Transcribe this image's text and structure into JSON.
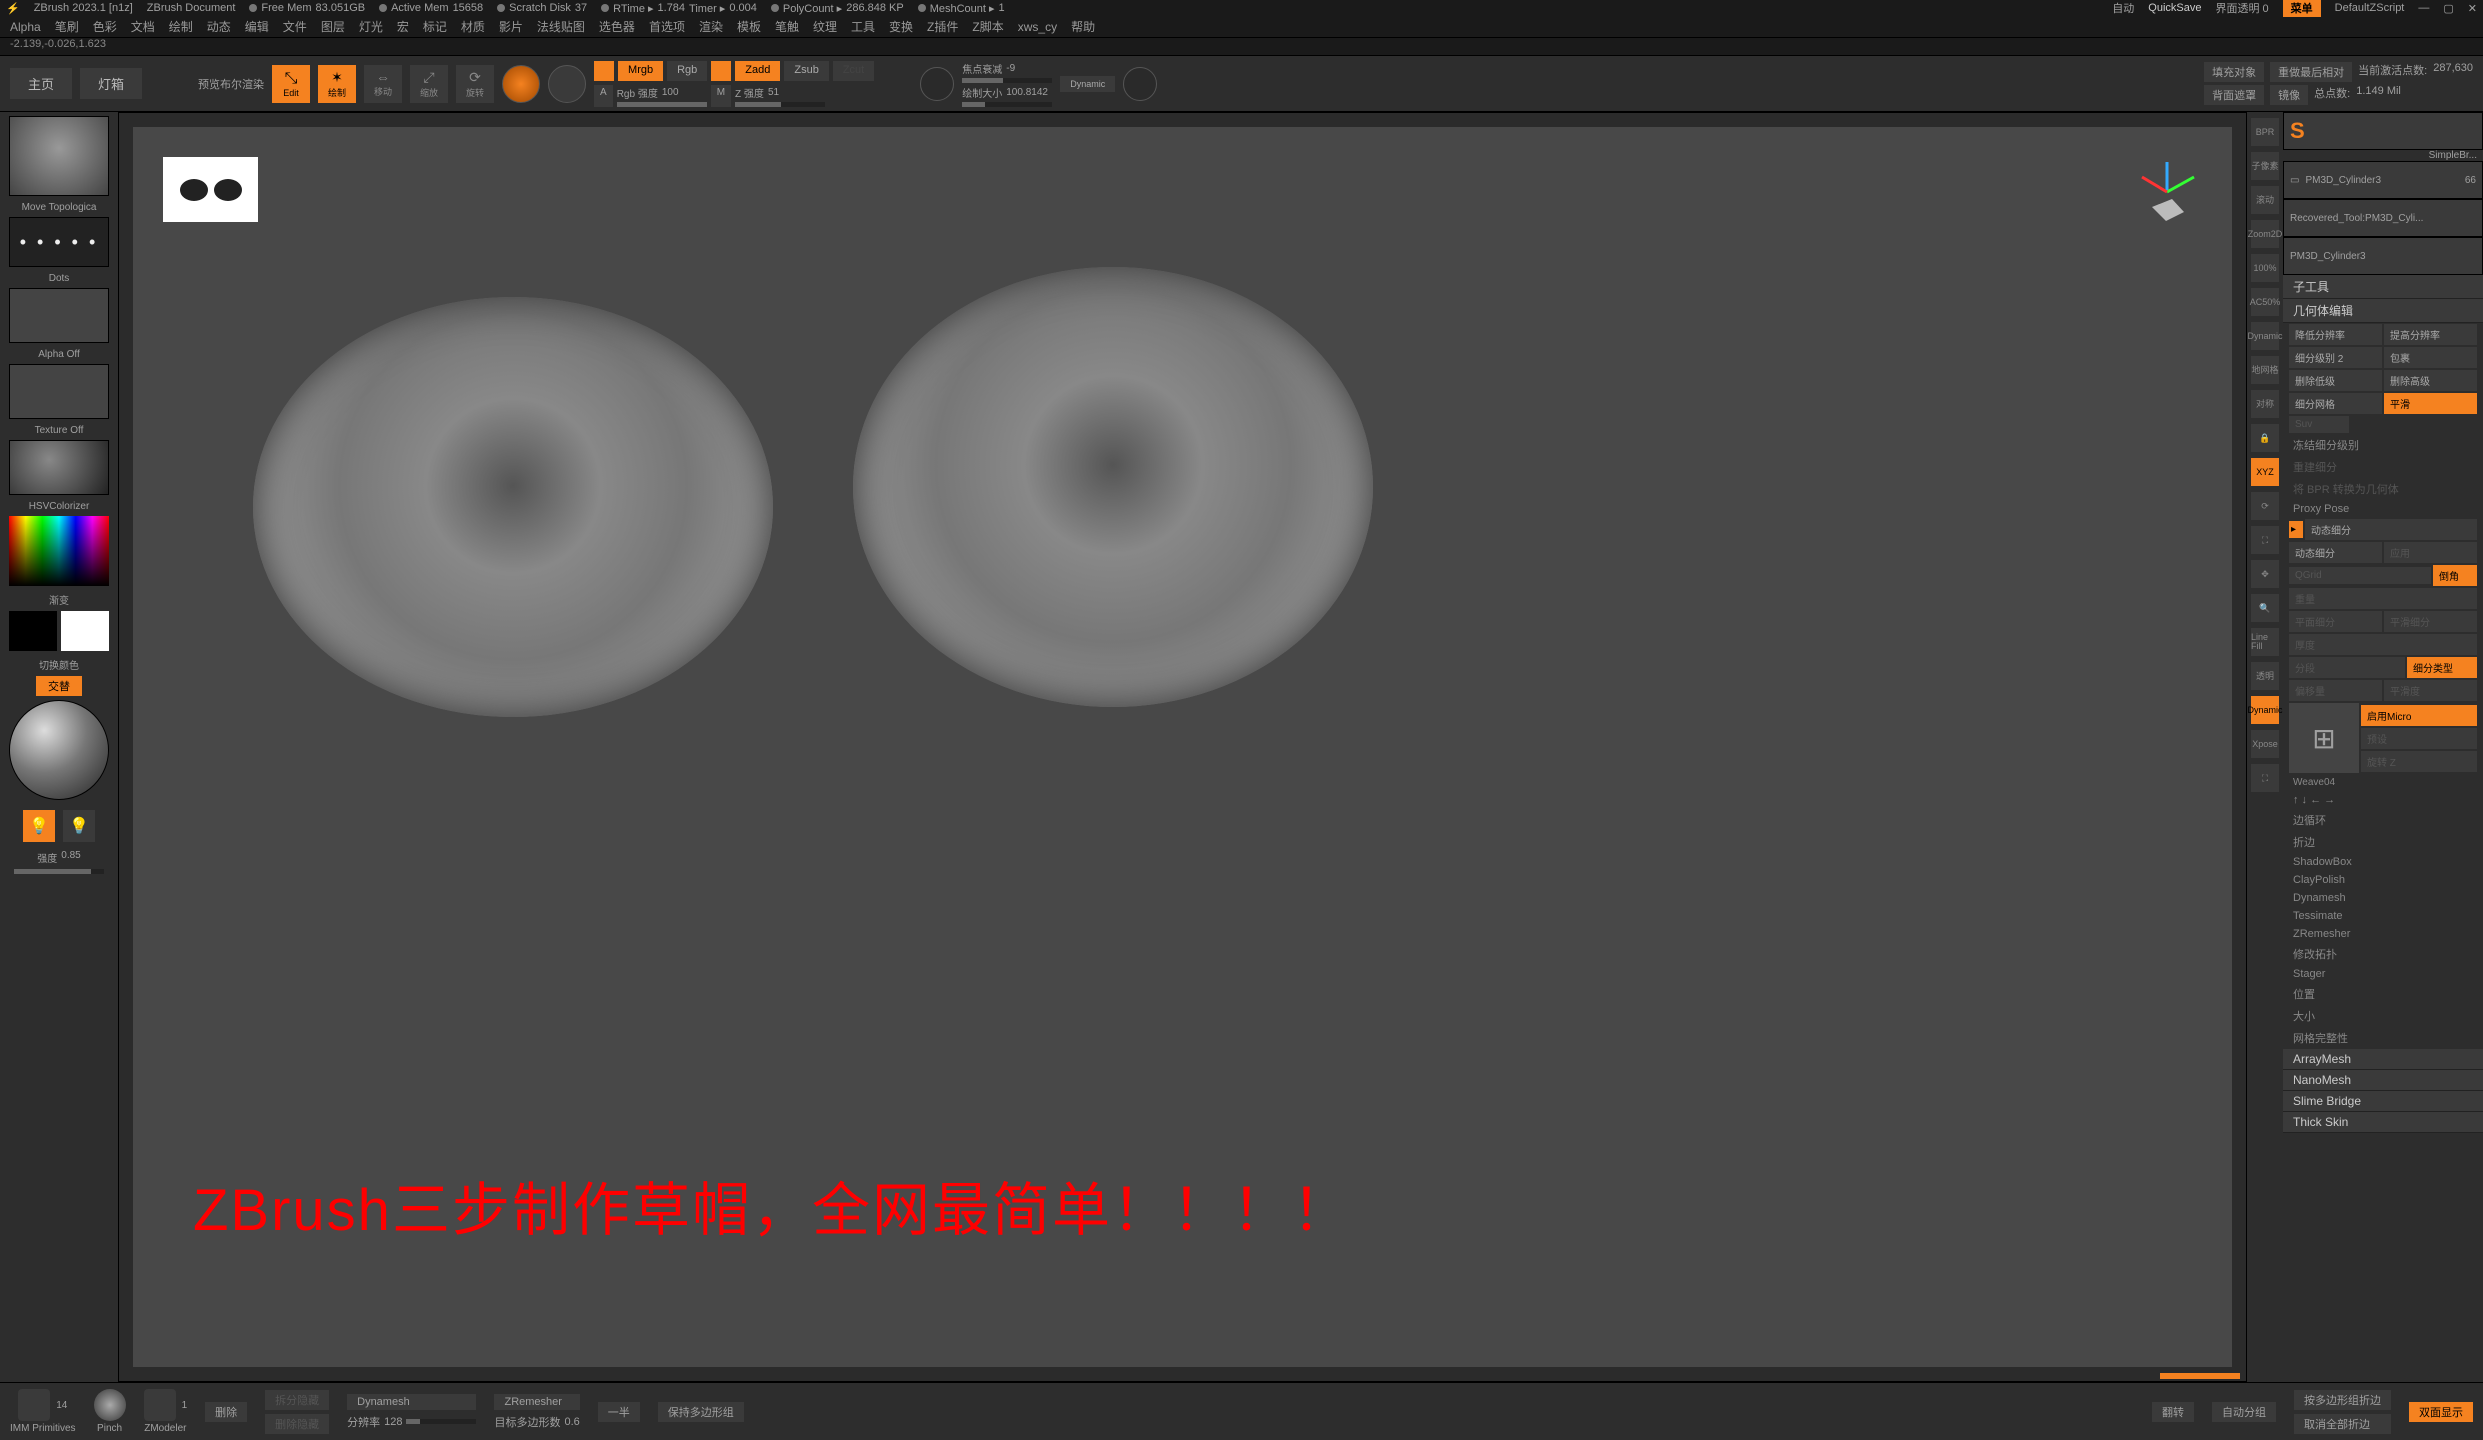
{
  "titlebar": {
    "app": "ZBrush 2023.1 [n1z]",
    "doc": "ZBrush Document",
    "freemem_label": "Free Mem",
    "freemem_val": "83.051GB",
    "activemem_label": "Active Mem",
    "activemem_val": "15658",
    "scratch_label": "Scratch Disk",
    "scratch_val": "37",
    "rtime_label": "RTime ▸",
    "rtime_val": "1.784",
    "timer_label": "Timer ▸",
    "timer_val": "0.004",
    "polycount_label": "PolyCount ▸",
    "polycount_val": "286.848 KP",
    "meshcount_label": "MeshCount ▸",
    "meshcount_val": "1",
    "auto": "自动",
    "quicksave": "QuickSave",
    "uiopacity": "界面透明 0",
    "menu": "菜单",
    "defaultscript": "DefaultZScript"
  },
  "menubar": [
    "Alpha",
    "笔刷",
    "色彩",
    "文档",
    "绘制",
    "动态",
    "编辑",
    "文件",
    "图层",
    "灯光",
    "宏",
    "标记",
    "材质",
    "影片",
    "法线贴图",
    "选色器",
    "首选项",
    "渲染",
    "模板",
    "笔触",
    "纹理",
    "工具",
    "变换",
    "Z插件",
    "Z脚本",
    "xws_cy",
    "帮助"
  ],
  "coords": "-2.139,-0.026,1.623",
  "toolrow": {
    "tab_home": "主页",
    "tab_lightbox": "灯箱",
    "preview": "预览布尔渲染",
    "edit": "Edit",
    "draw": "绘制",
    "move": "移动",
    "scale": "缩放",
    "rotate": "旋转",
    "a": "A",
    "mrgb": "Mrgb",
    "rgb": "Rgb",
    "m": "M",
    "zadd": "Zadd",
    "zsub": "Zsub",
    "zcut": "Zcut",
    "rgb_intensity_lbl": "Rgb 强度",
    "rgb_intensity_val": "100",
    "z_intensity_lbl": "Z 强度",
    "z_intensity_val": "51",
    "focal_lbl": "焦点衰减",
    "focal_val": "-9",
    "drawsize_lbl": "绘制大小",
    "drawsize_val": "100.8142",
    "dynamic": "Dynamic",
    "fill_obj": "填充对象",
    "redo_last": "重做最后相对",
    "backface": "背面遮罩",
    "mirror": "镜像",
    "active_pts_lbl": "当前激活点数:",
    "active_pts_val": "287,630",
    "total_pts_lbl": "总点数:",
    "total_pts_val": "1.149 Mil"
  },
  "leftcol": {
    "brush_name": "Move Topologica",
    "stroke": "Dots",
    "alpha": "Alpha Off",
    "texture": "Texture Off",
    "colorizer": "HSVColorizer",
    "gradient": "渐变",
    "swapcolor": "切换颜色",
    "exchange": "交替",
    "intensity_lbl": "强度",
    "intensity_val": "0.85"
  },
  "vpicons": {
    "bpr": "BPR",
    "subpix": "子像素",
    "scroll": "滚动",
    "zoom2d": "Zoom2D",
    "actual": "100%",
    "ac50": "AC50%",
    "dynamic": "Dynamic",
    "pgrid": "地网格",
    "symm": "对称",
    "lock": "🔒",
    "xyz": "XYZ",
    "rotate": "⟳",
    "frame": "⛶",
    "move": "✥",
    "zoom": "🔍",
    "linefill": "Line Fill",
    "transp": "透明",
    "dynsub": "Dynamic",
    "xpose": "Xpose",
    "isolate": "⛶"
  },
  "rightcol": {
    "simplebrush": "SimpleBr...",
    "tool1": "PM3D_Cylinder3",
    "tool1_count": "66",
    "tool2": "Recovered_Tool:PM3D_Cyli...",
    "tool3": "PM3D_Cylinder3",
    "subtool": "子工具",
    "geometry": "几何体编辑",
    "lowres": "降低分辨率",
    "highres": "提高分辨率",
    "sdiv_lbl": "细分级别",
    "sdiv_val": "2",
    "cage": "包裹",
    "del_low": "删除低级",
    "del_high": "删除高级",
    "divide": "细分网格",
    "smooth": "平滑",
    "suv": "Suv",
    "freeze_sdiv": "冻结细分级别",
    "reconstruct": "重建细分",
    "bpr_to_geo": "将 BPR 转换为几何体",
    "proxy": "Proxy Pose",
    "dynamic_sub": "动态细分",
    "dyn_sub2": "动态细分",
    "apply": "应用",
    "qgrid": "QGrid",
    "chamfer": "倒角",
    "weight": "重量",
    "flat_sub": "平面细分",
    "smooth_sub": "平滑细分",
    "thickness": "厚度",
    "segments": "分段",
    "sub_exp": "细分类型",
    "offset": "偏移量",
    "smoothness": "平滑度",
    "enable_micro": "启用Micro",
    "preset": "预设",
    "rotate_z": "旋转 Z",
    "weave": "Weave04",
    "arrows": "↑  ↓  ←  →",
    "edgeloop": "边循环",
    "crease": "折边",
    "shadowbox": "ShadowBox",
    "claypolish": "ClayPolish",
    "dynamesh": "Dynamesh",
    "tessimate": "Tessimate",
    "zremesher": "ZRemesher",
    "mod_topo": "修改拓扑",
    "stager": "Stager",
    "position": "位置",
    "size": "大小",
    "mesh_integrity": "网格完整性",
    "arraymesh": "ArrayMesh",
    "nanomesh": "NanoMesh",
    "slimebridge": "Slime Bridge",
    "thickskin": "Thick Skin"
  },
  "bottombar": {
    "imm_count": "14",
    "imm_name": "IMM Primitives",
    "pinch": "Pinch",
    "zmodeler": "ZModeler",
    "zm_count": "1",
    "delete": "删除",
    "split_hidden": "拆分隐藏",
    "del_hidden": "删除隐藏",
    "dynamesh": "Dynamesh",
    "res_lbl": "分辨率",
    "res_val": "128",
    "zremesher": "ZRemesher",
    "half": "一半",
    "keep_polygroups": "保持多边形组",
    "target_lbl": "目标多边形数",
    "target_val": "0.6",
    "flip": "翻转",
    "autogroup": "自动分组",
    "crease_pg": "按多边形组折边",
    "uncrease_all": "取消全部折边",
    "two_sided": "双面显示"
  },
  "overlay_text": "ZBrush三步制作草帽，全网最简单！！！！"
}
